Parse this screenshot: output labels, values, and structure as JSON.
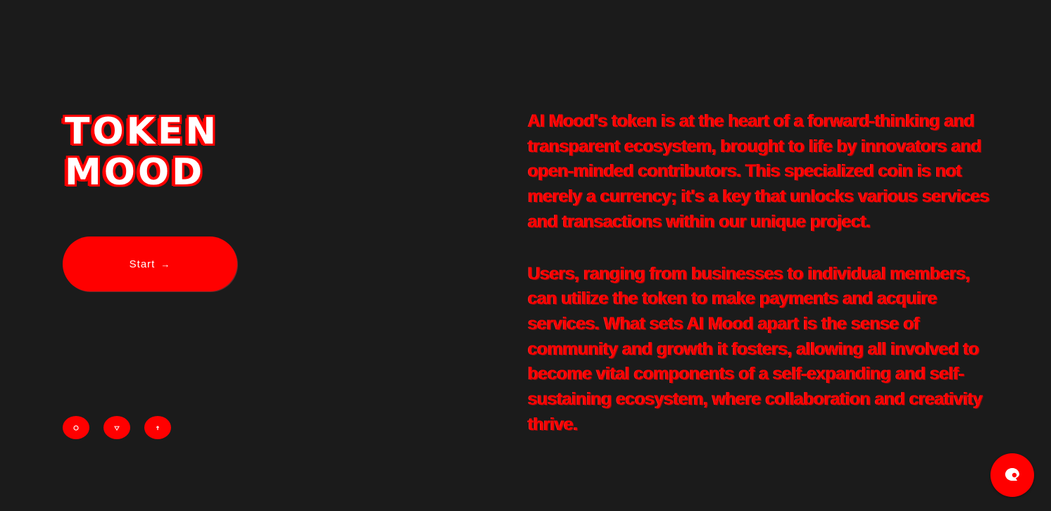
{
  "hero": {
    "title_line1": "TOKEN",
    "title_line2": "MOOD",
    "cta_label": "Start",
    "cta_icon": "arrow-right-icon"
  },
  "socials": [
    {
      "icon": "social-icon-1"
    },
    {
      "icon": "social-icon-2"
    },
    {
      "icon": "social-icon-3"
    }
  ],
  "description": {
    "paragraph1": "AI Mood's token is at the heart of a forward-thinking and transparent ecosystem, brought to life by innovators and open-minded contributors. This specialized coin is not merely a currency; it's a key that unlocks various services and transactions within our unique project.",
    "paragraph2": "Users, ranging from businesses to individual members, can utilize the token to make payments and acquire services. What sets AI Mood apart is the sense of community and growth it fosters, allowing all involved to become vital components of a self-expanding and self-sustaining ecosystem, where collaboration and creativity thrive."
  },
  "chat": {
    "icon": "chat-icon"
  },
  "colors": {
    "background": "#1b1b1b",
    "accent": "#ff0000",
    "text_light": "#ffffff"
  }
}
